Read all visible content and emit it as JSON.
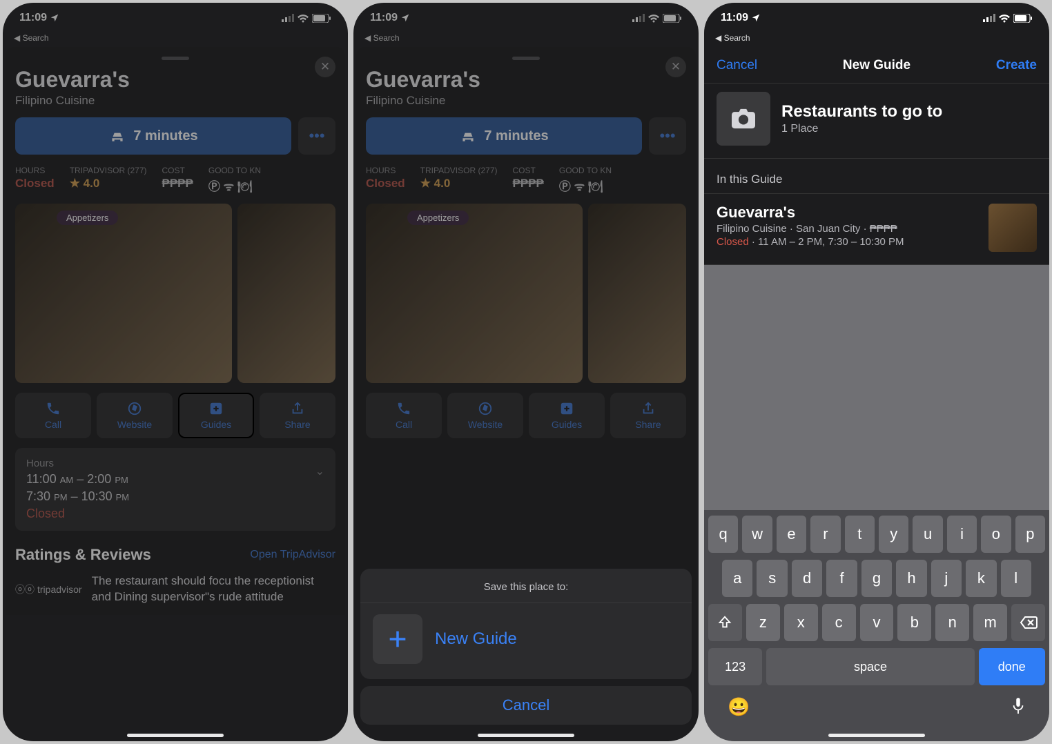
{
  "status": {
    "time": "11:09",
    "back": "Search"
  },
  "place": {
    "name": "Guevarra's",
    "subtitle": "Filipino Cuisine",
    "directions": "7 minutes",
    "hours_label": "HOURS",
    "hours_value": "Closed",
    "trip_label": "TRIPADVISOR (277)",
    "trip_value": "4.0",
    "cost_label": "COST",
    "cost_value": "₱₱₱₱",
    "good_label": "GOOD TO KN",
    "photo_tag": "Appetizers"
  },
  "actions": {
    "call": "Call",
    "website": "Website",
    "guides": "Guides",
    "share": "Share"
  },
  "hours_card": {
    "label": "Hours",
    "line1_a": "11:00",
    "line1_am": "AM",
    "line1_dash": " – ",
    "line1_b": "2:00",
    "line1_pm": "PM",
    "line2_a": "7:30",
    "line2_pm1": "PM",
    "line2_dash": " – ",
    "line2_b": "10:30",
    "line2_pm2": "PM",
    "closed": "Closed"
  },
  "reviews": {
    "title": "Ratings & Reviews",
    "link": "Open TripAdvisor",
    "source": "tripadvisor",
    "snippet": "The restaurant should focu the receptionist and Dining supervisor\"s rude attitude"
  },
  "sheet2": {
    "title": "Save this place to:",
    "new_guide": "New Guide",
    "cancel": "Cancel"
  },
  "guide3": {
    "cancel": "Cancel",
    "title": "New Guide",
    "create": "Create",
    "name": "Restaurants to go to",
    "count": "1 Place",
    "section": "In this Guide",
    "item_name": "Guevarra's",
    "item_line": "Filipino Cuisine · San Juan City · ",
    "item_cost": "₱₱₱₱",
    "item_closed": "Closed",
    "item_hours": " · 11 AM – 2 PM, 7:30 – 10:30 PM"
  },
  "keys_r1": [
    "q",
    "w",
    "e",
    "r",
    "t",
    "y",
    "u",
    "i",
    "o",
    "p"
  ],
  "keys_r2": [
    "a",
    "s",
    "d",
    "f",
    "g",
    "h",
    "j",
    "k",
    "l"
  ],
  "keys_r3": [
    "z",
    "x",
    "c",
    "v",
    "b",
    "n",
    "m"
  ],
  "kb": {
    "num": "123",
    "space": "space",
    "done": "done"
  }
}
